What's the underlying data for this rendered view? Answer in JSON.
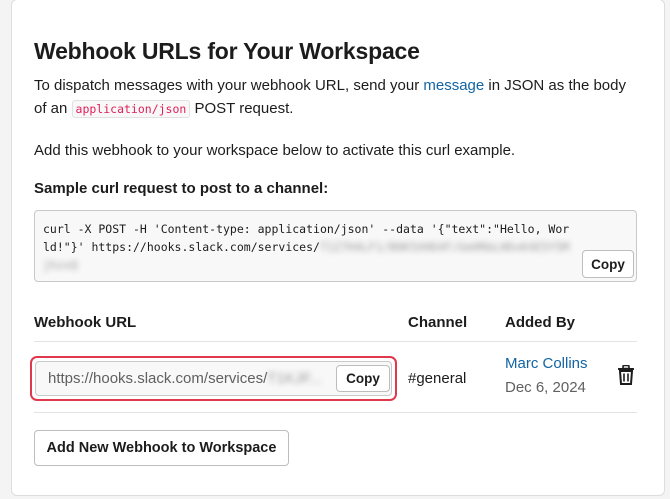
{
  "page": {
    "title": "Webhook URLs for Your Workspace",
    "description": {
      "part1": "To dispatch messages with your webhook URL, send your ",
      "link": "message",
      "part2": " in JSON as the body of an ",
      "code": "application/json",
      "part3": " POST request."
    },
    "hint": "Add this webhook to your workspace below to activate this curl example.",
    "sample_label": "Sample curl request to post to a channel:",
    "curl": {
      "visible": "curl -X POST -H 'Content-type: application/json' --data '{\"text\":\"Hello, World!\"}' https://hooks.slack.com/services/",
      "redacted": "T1Z7H4LF1/B0K5XHD4F/Gm9RbLHDvK4E5Y5MjhzxQ",
      "copy_label": "Copy"
    }
  },
  "table": {
    "headers": {
      "url": "Webhook URL",
      "channel": "Channel",
      "added_by": "Added By"
    },
    "rows": [
      {
        "url": "https://hooks.slack.com/services/",
        "url_redacted": "T1KJF...",
        "copy_label": "Copy",
        "channel": "#general",
        "added_by": "Marc Collins",
        "date": "Dec 6, 2024"
      }
    ]
  },
  "actions": {
    "add_label": "Add New Webhook to Workspace"
  },
  "icons": {
    "delete": "trash-icon"
  },
  "colors": {
    "link": "#1264a3",
    "highlight": "#e0394b",
    "code": "#e01e5a"
  }
}
